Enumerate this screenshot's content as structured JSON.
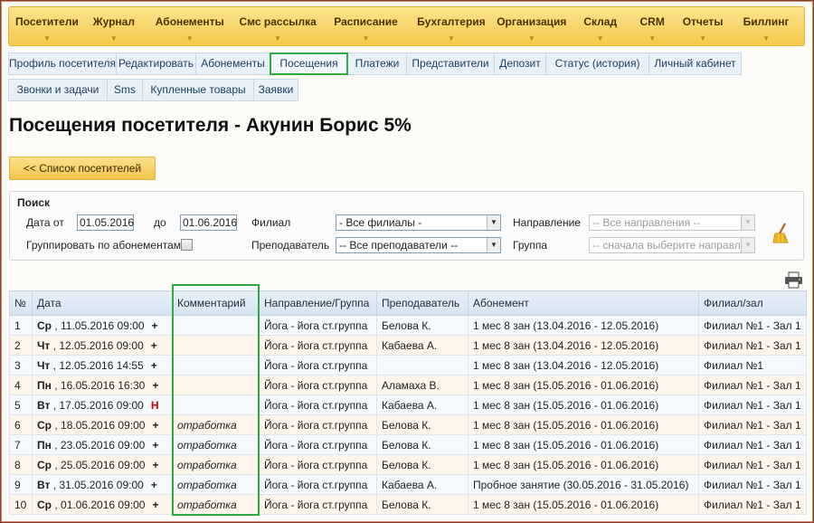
{
  "top_menu": [
    {
      "label": "Посетители"
    },
    {
      "label": "Журнал"
    },
    {
      "label": "Абонементы"
    },
    {
      "label": "Смс рассылка"
    },
    {
      "label": "Расписание"
    },
    {
      "label": "Бухгалтерия"
    },
    {
      "label": "Организация"
    },
    {
      "label": "Склад"
    },
    {
      "label": "CRM"
    },
    {
      "label": "Отчеты"
    },
    {
      "label": "Биллинг"
    }
  ],
  "tabs_row1": [
    {
      "label": "Профиль посетителя"
    },
    {
      "label": "Редактировать"
    },
    {
      "label": "Абонементы"
    },
    {
      "label": "Посещения"
    },
    {
      "label": "Платежи"
    },
    {
      "label": "Представители"
    },
    {
      "label": "Депозит"
    },
    {
      "label": "Статус (история)"
    },
    {
      "label": "Личный кабинет"
    }
  ],
  "tabs_row2": [
    {
      "label": "Звонки и задачи"
    },
    {
      "label": "Sms"
    },
    {
      "label": "Купленные товары"
    },
    {
      "label": "Заявки"
    }
  ],
  "active_tab": "Посещения",
  "page_title": "Посещения посетителя - Акунин Борис 5%",
  "back_button": "<< Список посетителей",
  "search": {
    "title": "Поиск",
    "date_from_label": "Дата от",
    "date_from": "01.05.2016",
    "date_to_label": "до",
    "date_to": "01.06.2016",
    "group_label": "Группировать по абонементам",
    "branch_label": "Филиал",
    "branch_value": "- Все филиалы -",
    "teacher_label": "Преподаватель",
    "teacher_value": "-- Все преподаватели --",
    "direction_label": "Направление",
    "direction_value": "-- Все направления --",
    "group2_label": "Группа",
    "group2_value": "-- сначала выберите направлен"
  },
  "table": {
    "headers": [
      "№",
      "Дата",
      "Комментарий",
      "Направление/Группа",
      "Преподаватель",
      "Абонемент",
      "Филиал/зал"
    ],
    "rows": [
      {
        "n": "1",
        "dow": "Ср",
        "date": "11.05.2016 09:00",
        "mark": "+",
        "comment": "",
        "direction": "Йога - йога ст.группа",
        "teacher": "Белова К.",
        "subscription": "1 мес 8 зан (13.04.2016 - 12.05.2016)",
        "branch": "Филиал №1 - Зал 1"
      },
      {
        "n": "2",
        "dow": "Чт",
        "date": "12.05.2016 09:00",
        "mark": "+",
        "comment": "",
        "direction": "Йога - йога ст.группа",
        "teacher": "Кабаева А.",
        "subscription": "1 мес 8 зан (13.04.2016 - 12.05.2016)",
        "branch": "Филиал №1 - Зал 1"
      },
      {
        "n": "3",
        "dow": "Чт",
        "date": "12.05.2016 14:55",
        "mark": "+",
        "comment": "",
        "direction": "Йога - йога ст.группа",
        "teacher": "",
        "subscription": "1 мес 8 зан (13.04.2016 - 12.05.2016)",
        "branch": "Филиал №1"
      },
      {
        "n": "4",
        "dow": "Пн",
        "date": "16.05.2016 16:30",
        "mark": "+",
        "comment": "",
        "direction": "Йога - йога ст.группа",
        "teacher": "Аламаха В.",
        "subscription": "1 мес 8 зан (15.05.2016 - 01.06.2016)",
        "branch": "Филиал №1 - Зал 1"
      },
      {
        "n": "5",
        "dow": "Вт",
        "date": "17.05.2016 09:00",
        "mark": "Н",
        "comment": "",
        "direction": "Йога - йога ст.группа",
        "teacher": "Кабаева А.",
        "subscription": "1 мес 8 зан (15.05.2016 - 01.06.2016)",
        "branch": "Филиал №1 - Зал 1"
      },
      {
        "n": "6",
        "dow": "Ср",
        "date": "18.05.2016 09:00",
        "mark": "+",
        "comment": "отработка",
        "direction": "Йога - йога ст.группа",
        "teacher": "Белова К.",
        "subscription": "1 мес 8 зан (15.05.2016 - 01.06.2016)",
        "branch": "Филиал №1 - Зал 1"
      },
      {
        "n": "7",
        "dow": "Пн",
        "date": "23.05.2016 09:00",
        "mark": "+",
        "comment": "отработка",
        "direction": "Йога - йога ст.группа",
        "teacher": "Белова К.",
        "subscription": "1 мес 8 зан (15.05.2016 - 01.06.2016)",
        "branch": "Филиал №1 - Зал 1"
      },
      {
        "n": "8",
        "dow": "Ср",
        "date": "25.05.2016 09:00",
        "mark": "+",
        "comment": "отработка",
        "direction": "Йога - йога ст.группа",
        "teacher": "Белова К.",
        "subscription": "1 мес 8 зан (15.05.2016 - 01.06.2016)",
        "branch": "Филиал №1 - Зал 1"
      },
      {
        "n": "9",
        "dow": "Вт",
        "date": "31.05.2016 09:00",
        "mark": "+",
        "comment": "отработка",
        "direction": "Йога - йога ст.группа",
        "teacher": "Кабаева А.",
        "subscription": "Пробное занятие (30.05.2016 - 31.05.2016)",
        "branch": "Филиал №1 - Зал 1"
      },
      {
        "n": "10",
        "dow": "Ср",
        "date": "01.06.2016 09:00",
        "mark": "+",
        "comment": "отработка",
        "direction": "Йога - йога ст.группа",
        "teacher": "Белова К.",
        "subscription": "1 мес 8 зан (15.05.2016 - 01.06.2016)",
        "branch": "Филиал №1 - Зал 1"
      }
    ]
  },
  "colors": {
    "menu_gold": "#f4c94b",
    "highlight_green": "#2eaa3e",
    "absence_red": "#d40000"
  }
}
